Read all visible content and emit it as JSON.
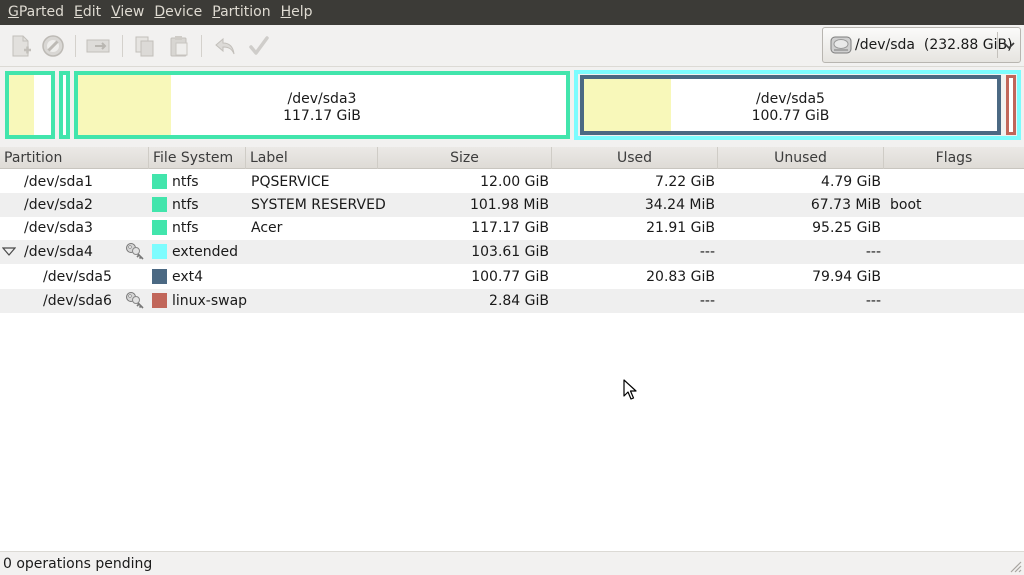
{
  "menu": {
    "items": [
      {
        "label": "GParted",
        "mnemonic": "G",
        "rest": "Parted"
      },
      {
        "label": "Edit",
        "mnemonic": "E",
        "rest": "dit"
      },
      {
        "label": "View",
        "mnemonic": "V",
        "rest": "iew"
      },
      {
        "label": "Device",
        "mnemonic": "D",
        "rest": "evice"
      },
      {
        "label": "Partition",
        "mnemonic": "P",
        "rest": "artition"
      },
      {
        "label": "Help",
        "mnemonic": "H",
        "rest": "elp"
      }
    ]
  },
  "toolbar": {
    "icons": [
      "new-partition-icon",
      "delete-partition-icon",
      "resize-move-icon",
      "copy-icon",
      "paste-icon",
      "undo-icon",
      "apply-icon"
    ],
    "device_selector": {
      "device": "/dev/sda",
      "size": "(232.88 GiB)"
    }
  },
  "diskmap": {
    "sda3": {
      "name": "/dev/sda3",
      "size": "117.17 GiB",
      "used_fraction": 0.19
    },
    "sda5": {
      "name": "/dev/sda5",
      "size": "100.77 GiB",
      "used_fraction": 0.21
    },
    "sda1_used_fraction": 0.6,
    "colors": {
      "ntfs": "#42e5ac",
      "ext4": "#4b6983",
      "extended": "#7dfcfe",
      "linux-swap": "#c1665a",
      "used": "#f8f8ba"
    }
  },
  "table": {
    "columns": [
      "Partition",
      "File System",
      "Label",
      "Size",
      "Used",
      "Unused",
      "Flags"
    ],
    "rows": [
      {
        "partition": "/dev/sda1",
        "fs": "ntfs",
        "label": "PQSERVICE",
        "size": "12.00 GiB",
        "used": "7.22 GiB",
        "unused": "4.79 GiB",
        "flags": ""
      },
      {
        "partition": "/dev/sda2",
        "fs": "ntfs",
        "label": "SYSTEM RESERVED",
        "size": "101.98 MiB",
        "used": "34.24 MiB",
        "unused": "67.73 MiB",
        "flags": "boot"
      },
      {
        "partition": "/dev/sda3",
        "fs": "ntfs",
        "label": "Acer",
        "size": "117.17 GiB",
        "used": "21.91 GiB",
        "unused": "95.25 GiB",
        "flags": ""
      },
      {
        "partition": "/dev/sda4",
        "fs": "extended",
        "label": "",
        "size": "103.61 GiB",
        "used": "---",
        "unused": "---",
        "flags": ""
      },
      {
        "partition": "/dev/sda5",
        "fs": "ext4",
        "label": "",
        "size": "100.77 GiB",
        "used": "20.83 GiB",
        "unused": "79.94 GiB",
        "flags": ""
      },
      {
        "partition": "/dev/sda6",
        "fs": "linux-swap",
        "label": "",
        "size": "2.84 GiB",
        "used": "---",
        "unused": "---",
        "flags": ""
      }
    ]
  },
  "status": {
    "text": "0 operations pending"
  }
}
